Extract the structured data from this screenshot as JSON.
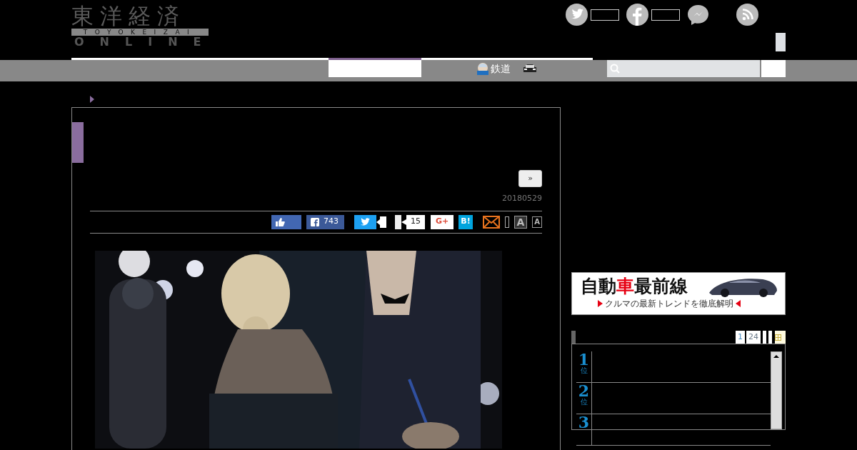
{
  "header": {
    "logo": {
      "title": "東洋経済",
      "subtitle": "TOYOKEIZAI",
      "tagline": "ONLINE"
    },
    "social": [
      {
        "kind": "twitter",
        "counter": true
      },
      {
        "kind": "facebook",
        "counter": true
      },
      {
        "kind": "messenger",
        "counter": false
      },
      {
        "kind": "rss",
        "counter": false
      }
    ]
  },
  "nav": {
    "items": [
      {
        "kind": "tab",
        "selected": true
      },
      {
        "kind": "link",
        "label": "鉄道",
        "selected": false
      },
      {
        "kind": "car",
        "selected": false
      }
    ]
  },
  "article": {
    "next_button": "»",
    "date": "20180529",
    "share": [
      {
        "kind": "like"
      },
      {
        "kind": "facebook",
        "count": "743"
      },
      {
        "kind": "twitter"
      },
      {
        "kind": "pocket",
        "count": "15"
      },
      {
        "kind": "google",
        "label": "G+"
      },
      {
        "kind": "hatena",
        "label": "B!"
      },
      {
        "kind": "mail"
      },
      {
        "kind": "font_large",
        "label": "A"
      },
      {
        "kind": "font_small",
        "label": "A"
      }
    ]
  },
  "sidebar": {
    "banner": {
      "title_parts": [
        {
          "text": "自動",
          "color": "#111111"
        },
        {
          "text": "車",
          "color": "#e60012"
        },
        {
          "text": "最前線",
          "color": "#111111"
        }
      ],
      "subtitle": "クルマの最新トレンドを徹底解明"
    },
    "ranking": {
      "tabs": [
        {
          "label": "1",
          "selected": true
        },
        {
          "label": "24",
          "selected": false
        }
      ],
      "items": [
        {
          "rank": "1",
          "suffix": "位"
        },
        {
          "rank": "2",
          "suffix": "位"
        },
        {
          "rank": "3"
        }
      ]
    }
  }
}
